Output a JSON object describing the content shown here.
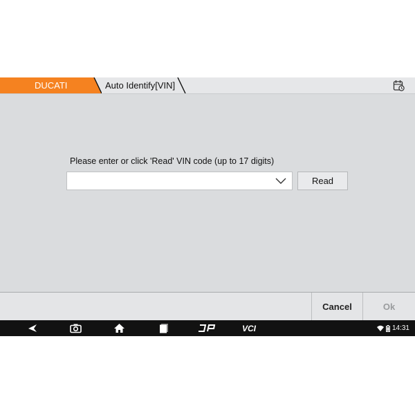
{
  "breadcrumb": {
    "brand": "DUCATI",
    "path": "Auto Identify[VIN]"
  },
  "content": {
    "prompt": "Please enter or click 'Read' VIN code (up to 17 digits)",
    "vin_value": "",
    "read_label": "Read"
  },
  "footer": {
    "cancel_label": "Cancel",
    "ok_label": "Ok"
  },
  "status_bar": {
    "time": "14:31"
  },
  "icons": {
    "log": "calendar-clock-icon",
    "back": "back-icon",
    "screenshot": "camera-icon",
    "home": "home-icon",
    "recents": "recents-icon",
    "dp": "dp-icon",
    "vci": "vci-icon",
    "wifi": "wifi-icon",
    "battery": "battery-icon"
  },
  "colors": {
    "accent": "#f58220",
    "background": "#dadcde",
    "navbar": "#121212"
  }
}
